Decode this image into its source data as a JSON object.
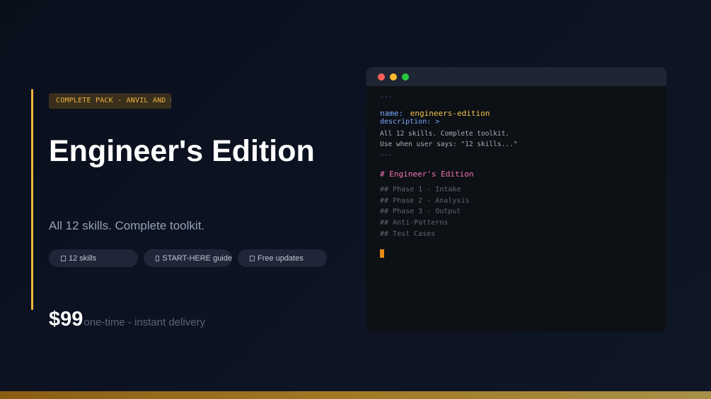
{
  "badge": "COMPLETE PACK - ANVIL AND CODE",
  "title": "Engineer's Edition",
  "subtitle": "All 12 skills. Complete toolkit.",
  "pills": [
    {
      "icon": "checkbox-icon",
      "label": "12 skills"
    },
    {
      "icon": "checkbox-icon",
      "label": "START-HERE guide"
    },
    {
      "icon": "checkbox-icon",
      "label": "Free updates"
    }
  ],
  "price": "$99",
  "price_note": "one-time - instant delivery",
  "terminal": {
    "dash_open": "---",
    "name_key": "name:",
    "name_value": "engineers-edition",
    "description_key": "description: >",
    "desc_line1": "All 12 skills. Complete toolkit.",
    "desc_line2": "Use when user says: \"12 skills...\"",
    "dash_close": "---",
    "heading": "# Engineer's Edition",
    "sections": [
      "## Phase 1 - Intake",
      "## Phase 2 - Analysis",
      "## Phase 3 - Output",
      "## Anti-Patterns",
      "## Test Cases"
    ]
  },
  "colors": {
    "accent": "#f0b43c",
    "background": "#0a0f1c",
    "cursor": "#e58a14",
    "heading": "#f472b6",
    "yaml_key": "#7aa7ff",
    "yaml_value": "#f0c450"
  }
}
